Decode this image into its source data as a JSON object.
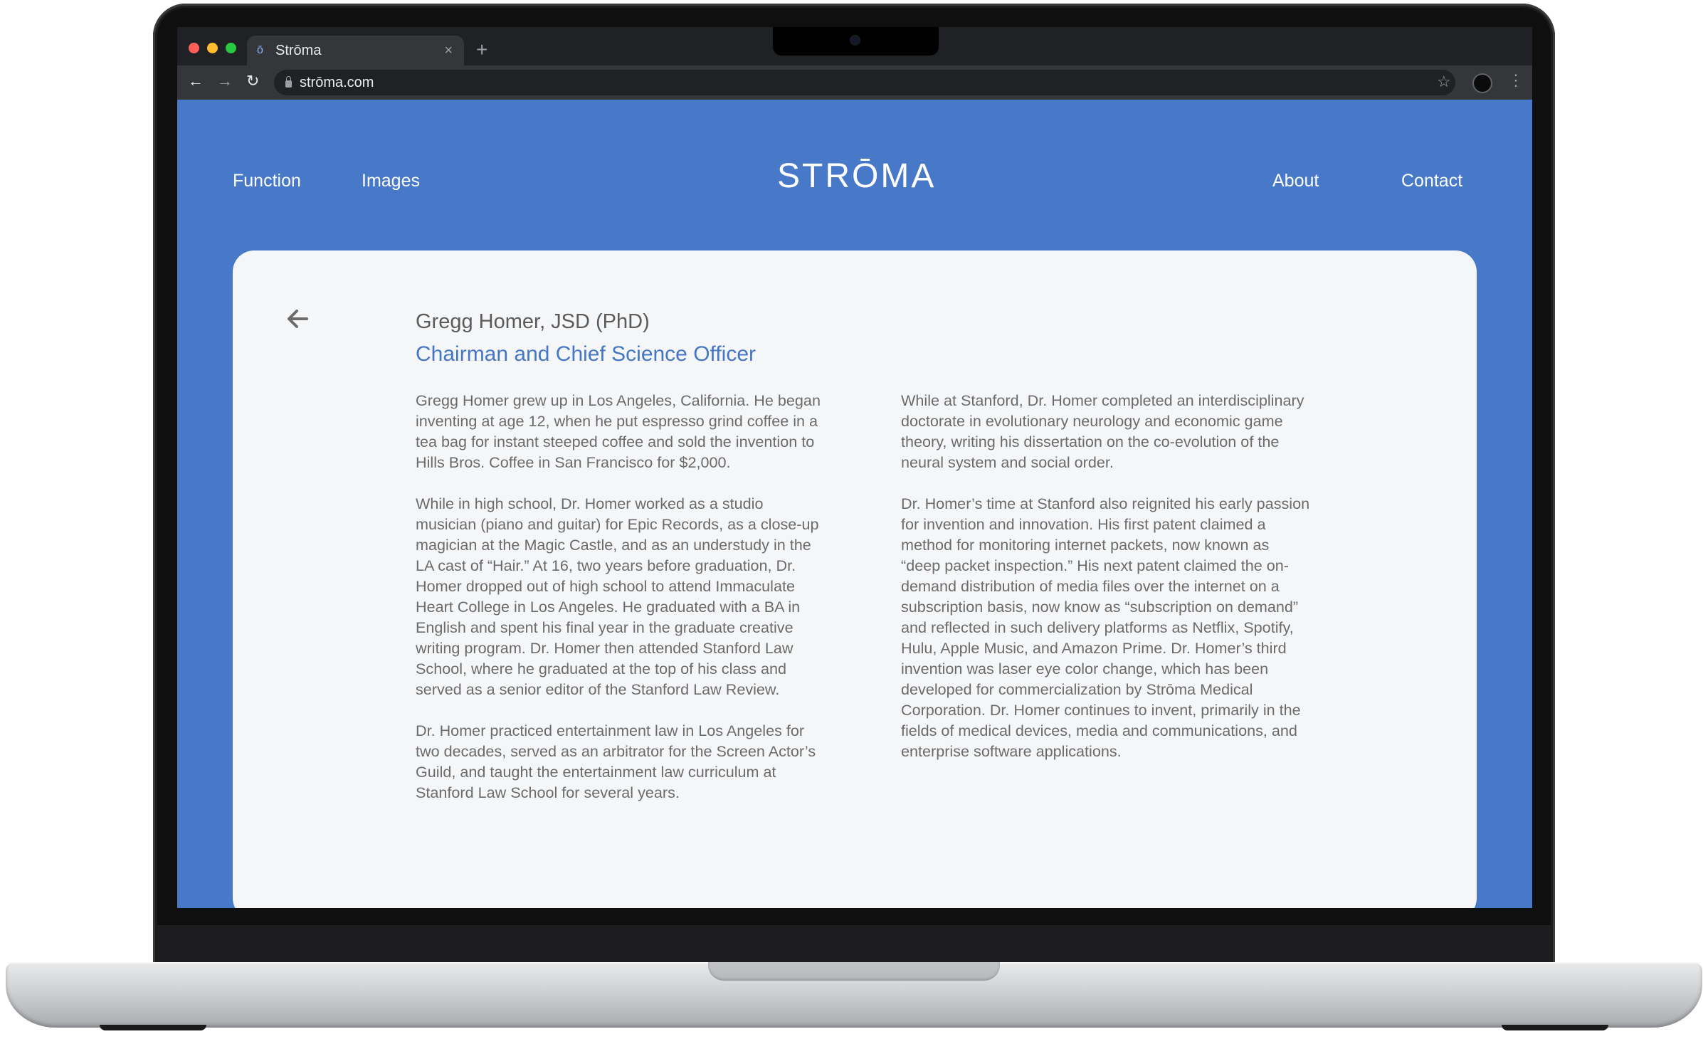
{
  "browser": {
    "tab": {
      "favicon": "ō",
      "title": "Strōma",
      "close": "×"
    },
    "new_tab": "+",
    "url": "strōma.com",
    "icons": [
      "back-icon",
      "forward-icon",
      "reload-icon",
      "lock-icon",
      "star-icon",
      "profile-icon",
      "menu-icon"
    ]
  },
  "site": {
    "logo": "STRŌMA",
    "nav": {
      "function": "Function",
      "images": "Images",
      "about": "About",
      "contact": "Contact"
    }
  },
  "profile": {
    "name": "Gregg Homer, JSD (PhD)",
    "role": "Chairman and Chief Science Officer",
    "bio_left": [
      "Gregg Homer grew up in Los Angeles, California. He began inventing at age 12, when he put espresso grind coffee in a tea bag for instant steeped coffee and sold the invention to Hills Bros. Coffee in San Francisco for $2,000.",
      "While in high school, Dr. Homer worked as a studio musician (piano and guitar) for Epic Records, as a close-up magician at the Magic Castle, and as an understudy in the LA cast of “Hair.” At 16, two years before graduation, Dr. Homer dropped out of high school to attend Immaculate Heart College in Los Angeles. He graduated with a BA in English and spent his final year in the graduate creative writing program. Dr. Homer then attended Stanford Law School, where he graduated at the top of his class and served as a senior editor of the Stanford Law Review.",
      "Dr. Homer practiced entertainment law in Los Angeles for two decades, served as an arbitrator for the Screen Actor’s Guild, and taught the entertainment law curriculum at Stanford Law School for several years."
    ],
    "bio_right": [
      "While at Stanford, Dr. Homer completed an interdisciplinary doctorate in evolutionary neurology and economic game theory, writing his dissertation on the co-evolution of the neural system and social order.",
      "Dr. Homer’s time at Stanford also reignited his early passion for invention and innovation. His first patent claimed a method for monitoring internet packets, now known as “deep packet inspection.” His next patent claimed the on-demand distribution of media files over the internet on a subscription basis, now know as “subscription on demand” and reflected in such delivery platforms as Netflix, Spotify, Hulu, Apple Music, and Amazon Prime. Dr. Homer’s third invention was laser eye color change, which has been developed for commercialization by Strōma Medical Corporation. Dr. Homer continues to invent, primarily in the fields of medical devices, media and communications, and enterprise software applications."
    ]
  },
  "colors": {
    "page_background": "#4779c8",
    "card_background": "#f5f6f8",
    "accent_title": "#4576c4",
    "body_text": "#6b6b6b"
  }
}
